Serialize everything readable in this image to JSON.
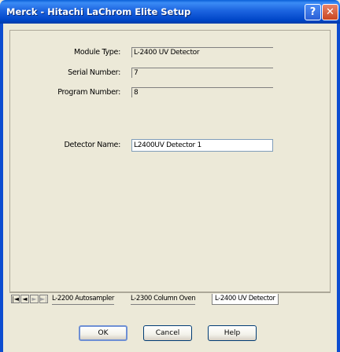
{
  "window": {
    "title": "Merck - Hitachi LaChrom Elite Setup",
    "help_glyph": "?",
    "close_glyph": "✕"
  },
  "form": {
    "module_type_label": "Module Type:",
    "module_type_value": "L-2400 UV Detector",
    "serial_number_label": "Serial Number:",
    "serial_number_value": "7",
    "program_number_label": "Program Number:",
    "program_number_value": "8",
    "detector_name_label": "Detector Name:",
    "detector_name_value": "L2400UV Detector 1"
  },
  "tabs": {
    "nav": [
      "|◄",
      "◄",
      "►",
      "►|"
    ],
    "items": [
      {
        "label": "L-2200 Autosampler",
        "active": false
      },
      {
        "label": "L-2300 Column Oven",
        "active": false
      },
      {
        "label": "L-2400 UV Detector",
        "active": true
      }
    ]
  },
  "buttons": {
    "ok": "OK",
    "cancel": "Cancel",
    "help": "Help"
  }
}
